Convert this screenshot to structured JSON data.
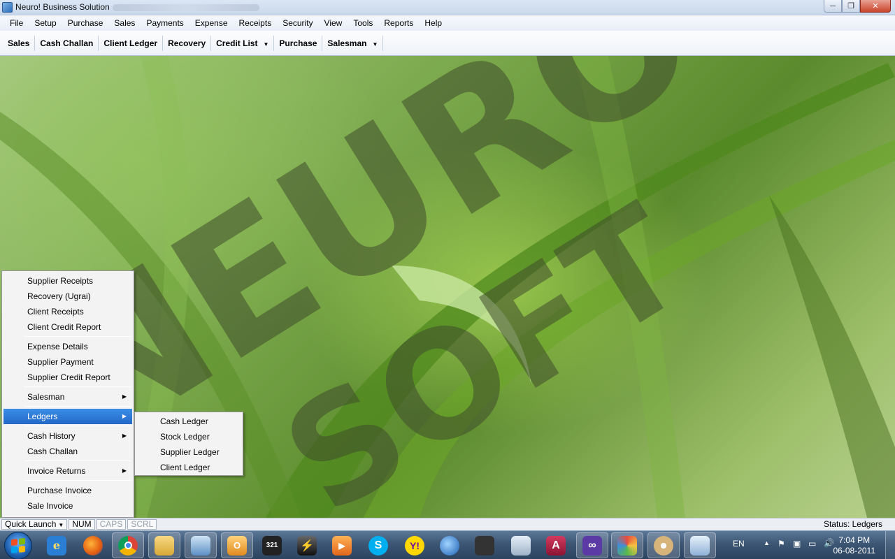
{
  "window": {
    "title": "Neuro! Business Solution",
    "buttons": {
      "minimize": "─",
      "maximize": "❐",
      "close": "✕"
    }
  },
  "menubar": [
    "File",
    "Setup",
    "Purchase",
    "Sales",
    "Payments",
    "Expense",
    "Receipts",
    "Security",
    "View",
    "Tools",
    "Reports",
    "Help"
  ],
  "toolbar": {
    "sales": "Sales",
    "cash_challan": "Cash Challan",
    "client_ledger": "Client Ledger",
    "recovery": "Recovery",
    "credit_list": "Credit List",
    "purchase": "Purchase",
    "salesman": "Salesman",
    "dropdown_arrow": "▼"
  },
  "popup_menu": {
    "items": [
      "Supplier Receipts",
      "Recovery (Ugrai)",
      "Client Receipts",
      "Client Credit Report",
      "Expense Details",
      "Supplier Payment",
      "Supplier Credit Report",
      "Salesman",
      "Ledgers",
      "Cash History",
      "Cash Challan",
      "Invoice Returns",
      "Purchase Invoice",
      "Sale Invoice"
    ],
    "submenu_arrow": "▶",
    "highlighted": "Ledgers"
  },
  "ledgers_submenu": [
    "Cash Ledger",
    "Stock Ledger",
    "Supplier Ledger",
    "Client Ledger"
  ],
  "statusbar": {
    "quick_launch": "Quick Launch",
    "num": "NUM",
    "caps": "CAPS",
    "scrl": "SCRL",
    "status": "Status: Ledgers"
  },
  "taskbar": {
    "icons": [
      "ie-icon",
      "firefox-icon",
      "chrome-icon",
      "explorer-icon",
      "control-panel-icon",
      "outlook-icon",
      "media-player-classic-icon",
      "winamp-icon",
      "media-player-icon",
      "skype-icon",
      "yahoo-messenger-icon",
      "google-earth-icon",
      "video-camera-icon",
      "keyboard-icon",
      "access-icon",
      "visual-studio-icon",
      "paint-splash-icon",
      "paint-icon",
      "app-icon"
    ],
    "language": "EN",
    "time": "7:04 PM",
    "date": "06-08-2011"
  },
  "colors": {
    "menu_highlight": "#2f7bd8",
    "taskbar": "#3c5674",
    "watermark": "#3f4d2c"
  }
}
